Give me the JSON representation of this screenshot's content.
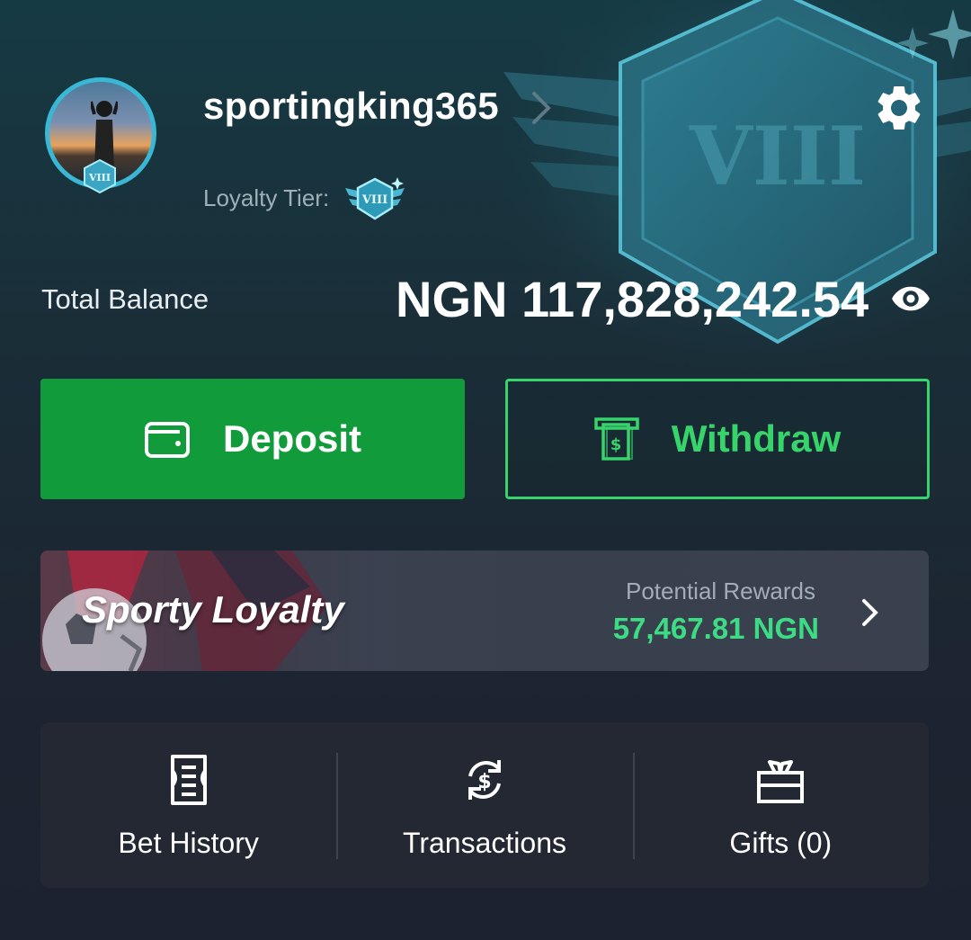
{
  "profile": {
    "username": "sportingking365",
    "loyalty_label": "Loyalty Tier:",
    "tier": "VIII"
  },
  "balance": {
    "label": "Total Balance",
    "amount": "NGN 117,828,242.54"
  },
  "actions": {
    "deposit_label": "Deposit",
    "withdraw_label": "Withdraw"
  },
  "loyalty_card": {
    "title": "Sporty Loyalty",
    "rewards_label": "Potential Rewards",
    "rewards_value": "57,467.81 NGN"
  },
  "quick_links": [
    {
      "label": "Bet History",
      "icon": "receipt-icon"
    },
    {
      "label": "Transactions",
      "icon": "currency-exchange-icon"
    },
    {
      "label": "Gifts (0)",
      "icon": "gift-icon"
    }
  ],
  "colors": {
    "accent_green": "#119b3b",
    "withdraw_green": "#37d46c",
    "rewards_green": "#3ddc84",
    "tier_blue": "#39b8d6"
  }
}
